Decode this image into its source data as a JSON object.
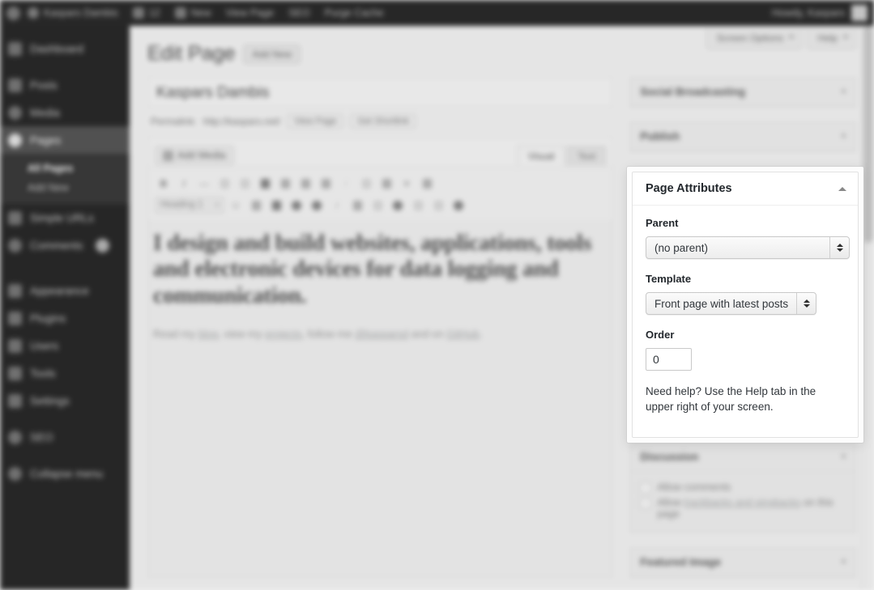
{
  "adminbar": {
    "logo_icon": "wordpress-logo-icon",
    "site_name": "Kaspars Dambis",
    "comments_label": "12",
    "comments_icon": "comment-bubble-icon",
    "new_label": "New",
    "new_icon": "plus-icon",
    "view_page_label": "View Page",
    "seo_label": "SEO",
    "purge_cache_label": "Purge Cache",
    "howdy": "Howdy, Kaspars",
    "avatar_name": "avatar"
  },
  "sidebar": {
    "items": [
      {
        "label": "Dashboard",
        "icon": "dashboard-icon"
      },
      {
        "label": "Posts",
        "icon": "pin-icon"
      },
      {
        "label": "Media",
        "icon": "media-icon"
      },
      {
        "label": "Pages",
        "icon": "page-icon",
        "current": true
      },
      {
        "label": "Simple URLs",
        "icon": "link-icon"
      },
      {
        "label": "Comments",
        "icon": "comment-icon",
        "badge": "1"
      },
      {
        "label": "Appearance",
        "icon": "brush-icon"
      },
      {
        "label": "Plugins",
        "icon": "plug-icon"
      },
      {
        "label": "Users",
        "icon": "users-icon"
      },
      {
        "label": "Tools",
        "icon": "tools-icon"
      },
      {
        "label": "Settings",
        "icon": "gear-icon"
      },
      {
        "label": "SEO",
        "icon": "seo-icon"
      },
      {
        "label": "Collapse menu",
        "icon": "collapse-icon"
      }
    ],
    "submenu": [
      {
        "label": "All Pages",
        "current": true
      },
      {
        "label": "Add New"
      }
    ]
  },
  "screen_meta": {
    "screen_options": "Screen Options",
    "help": "Help"
  },
  "page": {
    "title": "Edit Page",
    "add_new": "Add New",
    "post_title": "Kaspars Dambis",
    "permalink_label": "Permalink:",
    "permalink_url": "http://kaspars.net/",
    "view_page_btn": "View Page",
    "get_shortlink_btn": "Get Shortlink"
  },
  "editor": {
    "add_media": "Add Media",
    "tab_visual": "Visual",
    "tab_text": "Text",
    "format_select": "Heading 1",
    "heading": "I design and build websites, applications, tools and electronic devices for data logging and communication.",
    "paragraph_parts": {
      "p1": "Read my ",
      "l1": "blog",
      "p2": ", view my ",
      "l2": "projects",
      "p3": ", follow me ",
      "l3": "@kasparsd",
      "p4": " and on ",
      "l4": "GitHub",
      "p5": "."
    },
    "toolbar_row1": [
      "bold-icon",
      "italic-icon",
      "strikethrough-icon",
      "unordered-list-icon",
      "ordered-list-icon",
      "blockquote-icon",
      "align-left-icon",
      "align-center-icon",
      "align-right-icon",
      "link-icon",
      "unlink-icon",
      "read-more-icon",
      "spellcheck-icon",
      "fullscreen-icon"
    ],
    "toolbar_row2": [
      "underline-icon",
      "justify-icon",
      "text-color-icon",
      "paste-text-icon",
      "clear-formatting-icon",
      "special-character-icon",
      "outdent-icon",
      "indent-icon",
      "undo-icon",
      "redo-icon",
      "help-icon"
    ]
  },
  "metaboxes": {
    "social_broadcasting": "Social Broadcasting",
    "publish": "Publish",
    "discussion": {
      "title": "Discussion",
      "allow_comments": "Allow comments",
      "allow_trackbacks_pre": "Allow ",
      "allow_trackbacks_link": "trackbacks and pingbacks",
      "allow_trackbacks_post": " on this page"
    },
    "featured_image": "Featured Image"
  },
  "page_attributes": {
    "title": "Page Attributes",
    "collapse_icon": "chevron-up-icon",
    "parent_label": "Parent",
    "parent_value": "(no parent)",
    "template_label": "Template",
    "template_value": "Front page with latest posts",
    "order_label": "Order",
    "order_value": "0",
    "help_text": "Need help? Use the Help tab in the upper right of your screen."
  },
  "colors": {
    "admin_menu_bg": "#0a0a0a",
    "admin_bar_bg": "#0b0b0b",
    "content_bg": "#f1f1f1",
    "panel_bg": "#ffffff",
    "text_dark": "#23282d"
  }
}
